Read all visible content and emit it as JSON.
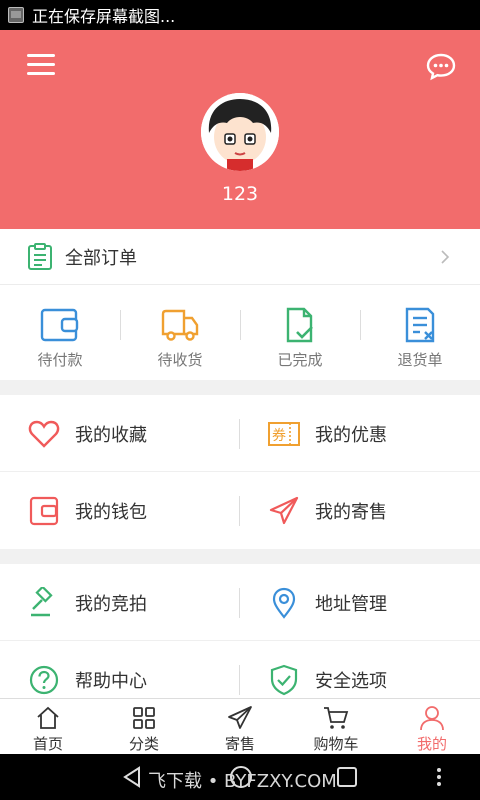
{
  "status_bar": {
    "notification": "正在保存屏幕截图..."
  },
  "header": {
    "username": "123",
    "bg_color": "#f26c6c"
  },
  "orders": {
    "title": "全部订单",
    "states": [
      {
        "label": "待付款",
        "icon": "wallet-icon",
        "color": "#3a8fd9"
      },
      {
        "label": "待收货",
        "icon": "truck-icon",
        "color": "#f0a030"
      },
      {
        "label": "已完成",
        "icon": "document-check-icon",
        "color": "#3cb371"
      },
      {
        "label": "退货单",
        "icon": "document-x-icon",
        "color": "#3a8fd9"
      }
    ]
  },
  "menu": {
    "section1": [
      {
        "label": "我的收藏",
        "icon": "heart-icon"
      },
      {
        "label": "我的优惠",
        "icon": "coupon-icon"
      },
      {
        "label": "我的钱包",
        "icon": "wallet-icon"
      },
      {
        "label": "我的寄售",
        "icon": "paper-plane-icon"
      }
    ],
    "section2": [
      {
        "label": "我的竞拍",
        "icon": "gavel-icon"
      },
      {
        "label": "地址管理",
        "icon": "location-pin-icon"
      },
      {
        "label": "帮助中心",
        "icon": "help-icon"
      },
      {
        "label": "安全选项",
        "icon": "shield-check-icon"
      }
    ]
  },
  "coupon_badge": "券",
  "tabbar": [
    {
      "label": "首页",
      "icon": "home-icon"
    },
    {
      "label": "分类",
      "icon": "grid-icon"
    },
    {
      "label": "寄售",
      "icon": "paper-plane-icon"
    },
    {
      "label": "购物车",
      "icon": "cart-icon"
    },
    {
      "label": "我的",
      "icon": "person-icon",
      "active": true
    }
  ],
  "nav_bar": {
    "watermark": "飞下载 • BYFZXY.COM"
  }
}
